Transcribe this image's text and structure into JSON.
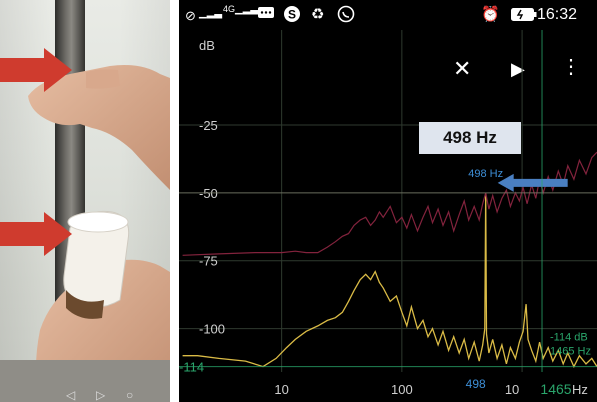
{
  "status_bar": {
    "time": "16:32",
    "network_label": "4G",
    "icons": [
      "no-sim-icon",
      "signal-icon",
      "4g-signal-icon",
      "messages-icon",
      "skype-icon",
      "sync-icon",
      "whatsapp-icon",
      "alarm-icon",
      "battery-icon"
    ]
  },
  "toolbar": {
    "icons": [
      "close-icon",
      "play-icon",
      "more-vert-icon"
    ]
  },
  "callout": {
    "label": "498 Hz",
    "arrow_color": "#4a7fc1"
  },
  "colors": {
    "background": "#000000",
    "grid": "#2f3a2f",
    "spectrum_trace": "#e6c54a",
    "peak_hold_trace": "#8a2540",
    "peak_marker": "#3d8ed6",
    "cursor_readout": "#2aa56b",
    "photo_arrow": "#cf3b2e"
  },
  "chart_data": {
    "type": "line",
    "ylabel": "dB",
    "xlabel": "Hz",
    "x_scale": "log",
    "y_ticks": [
      -25,
      -50,
      -75,
      -100
    ],
    "y_min_label": "-114",
    "x_ticks": [
      10,
      100
    ],
    "x_tick_labels": [
      "10",
      "100"
    ],
    "x_axis_partial_label": "10",
    "ylim": [
      -116,
      10
    ],
    "xlim": [
      1.4,
      4200
    ],
    "grid": true,
    "peak_marker": {
      "x": 498,
      "y": -50,
      "label": "498 Hz",
      "axis_label": "498"
    },
    "cursor": {
      "x": 1465,
      "y": -114,
      "db_label": "-114 dB",
      "hz_label": "1465 Hz",
      "axis_label": "1465"
    },
    "series": [
      {
        "points": [
          [
            1.5,
            -110
          ],
          [
            2,
            -110
          ],
          [
            3,
            -111
          ],
          [
            5,
            -112
          ],
          [
            7,
            -114
          ],
          [
            9,
            -111
          ],
          [
            11,
            -107
          ],
          [
            13,
            -104
          ],
          [
            16,
            -101
          ],
          [
            20,
            -99
          ],
          [
            24,
            -97
          ],
          [
            28,
            -96
          ],
          [
            32,
            -94
          ],
          [
            36,
            -90
          ],
          [
            40,
            -86
          ],
          [
            45,
            -82
          ],
          [
            50,
            -80
          ],
          [
            55,
            -82
          ],
          [
            60,
            -79
          ],
          [
            65,
            -83
          ],
          [
            70,
            -85
          ],
          [
            80,
            -90
          ],
          [
            90,
            -88
          ],
          [
            100,
            -94
          ],
          [
            110,
            -99
          ],
          [
            120,
            -92
          ],
          [
            135,
            -100
          ],
          [
            150,
            -97
          ],
          [
            165,
            -103
          ],
          [
            180,
            -100
          ],
          [
            200,
            -106
          ],
          [
            220,
            -101
          ],
          [
            245,
            -108
          ],
          [
            270,
            -103
          ],
          [
            300,
            -109
          ],
          [
            330,
            -104
          ],
          [
            360,
            -111
          ],
          [
            400,
            -105
          ],
          [
            440,
            -112
          ],
          [
            470,
            -106
          ],
          [
            490,
            -100
          ],
          [
            498,
            -50
          ],
          [
            506,
            -102
          ],
          [
            530,
            -109
          ],
          [
            570,
            -104
          ],
          [
            620,
            -111
          ],
          [
            680,
            -106
          ],
          [
            740,
            -113
          ],
          [
            800,
            -107
          ],
          [
            880,
            -111
          ],
          [
            950,
            -105
          ],
          [
            1020,
            -101
          ],
          [
            1080,
            -91
          ],
          [
            1120,
            -104
          ],
          [
            1200,
            -108
          ],
          [
            1300,
            -112
          ],
          [
            1400,
            -105
          ],
          [
            1500,
            -111
          ],
          [
            1650,
            -107
          ],
          [
            1800,
            -112
          ],
          [
            2000,
            -108
          ],
          [
            2200,
            -113
          ],
          [
            2400,
            -109
          ],
          [
            2700,
            -114
          ],
          [
            3000,
            -110
          ],
          [
            3400,
            -113
          ],
          [
            3800,
            -111
          ],
          [
            4200,
            -114
          ]
        ]
      },
      {
        "points": [
          [
            1.5,
            -73
          ],
          [
            3,
            -72.5
          ],
          [
            6,
            -72
          ],
          [
            10,
            -72
          ],
          [
            13,
            -71.5
          ],
          [
            16,
            -72
          ],
          [
            20,
            -72
          ],
          [
            24,
            -70
          ],
          [
            28,
            -68
          ],
          [
            32,
            -66
          ],
          [
            36,
            -65
          ],
          [
            40,
            -62
          ],
          [
            45,
            -60
          ],
          [
            50,
            -59
          ],
          [
            55,
            -62
          ],
          [
            60,
            -60
          ],
          [
            65,
            -57
          ],
          [
            70,
            -59
          ],
          [
            80,
            -55
          ],
          [
            90,
            -61
          ],
          [
            100,
            -59
          ],
          [
            110,
            -63
          ],
          [
            120,
            -58
          ],
          [
            135,
            -64
          ],
          [
            150,
            -59
          ],
          [
            165,
            -55
          ],
          [
            180,
            -61
          ],
          [
            200,
            -56
          ],
          [
            220,
            -62
          ],
          [
            245,
            -57
          ],
          [
            270,
            -64
          ],
          [
            300,
            -58
          ],
          [
            330,
            -53
          ],
          [
            360,
            -60
          ],
          [
            400,
            -55
          ],
          [
            440,
            -60
          ],
          [
            470,
            -54
          ],
          [
            498,
            -50
          ],
          [
            530,
            -56
          ],
          [
            570,
            -51
          ],
          [
            620,
            -57
          ],
          [
            680,
            -52
          ],
          [
            740,
            -49
          ],
          [
            800,
            -55
          ],
          [
            880,
            -50
          ],
          [
            950,
            -53
          ],
          [
            1020,
            -48
          ],
          [
            1100,
            -54
          ],
          [
            1200,
            -47
          ],
          [
            1300,
            -52
          ],
          [
            1400,
            -45
          ],
          [
            1500,
            -50
          ],
          [
            1650,
            -44
          ],
          [
            1800,
            -49
          ],
          [
            2000,
            -42
          ],
          [
            2200,
            -47
          ],
          [
            2400,
            -40
          ],
          [
            2700,
            -45
          ],
          [
            3000,
            -38
          ],
          [
            3400,
            -43
          ],
          [
            3800,
            -37
          ],
          [
            4200,
            -35
          ]
        ]
      }
    ]
  }
}
